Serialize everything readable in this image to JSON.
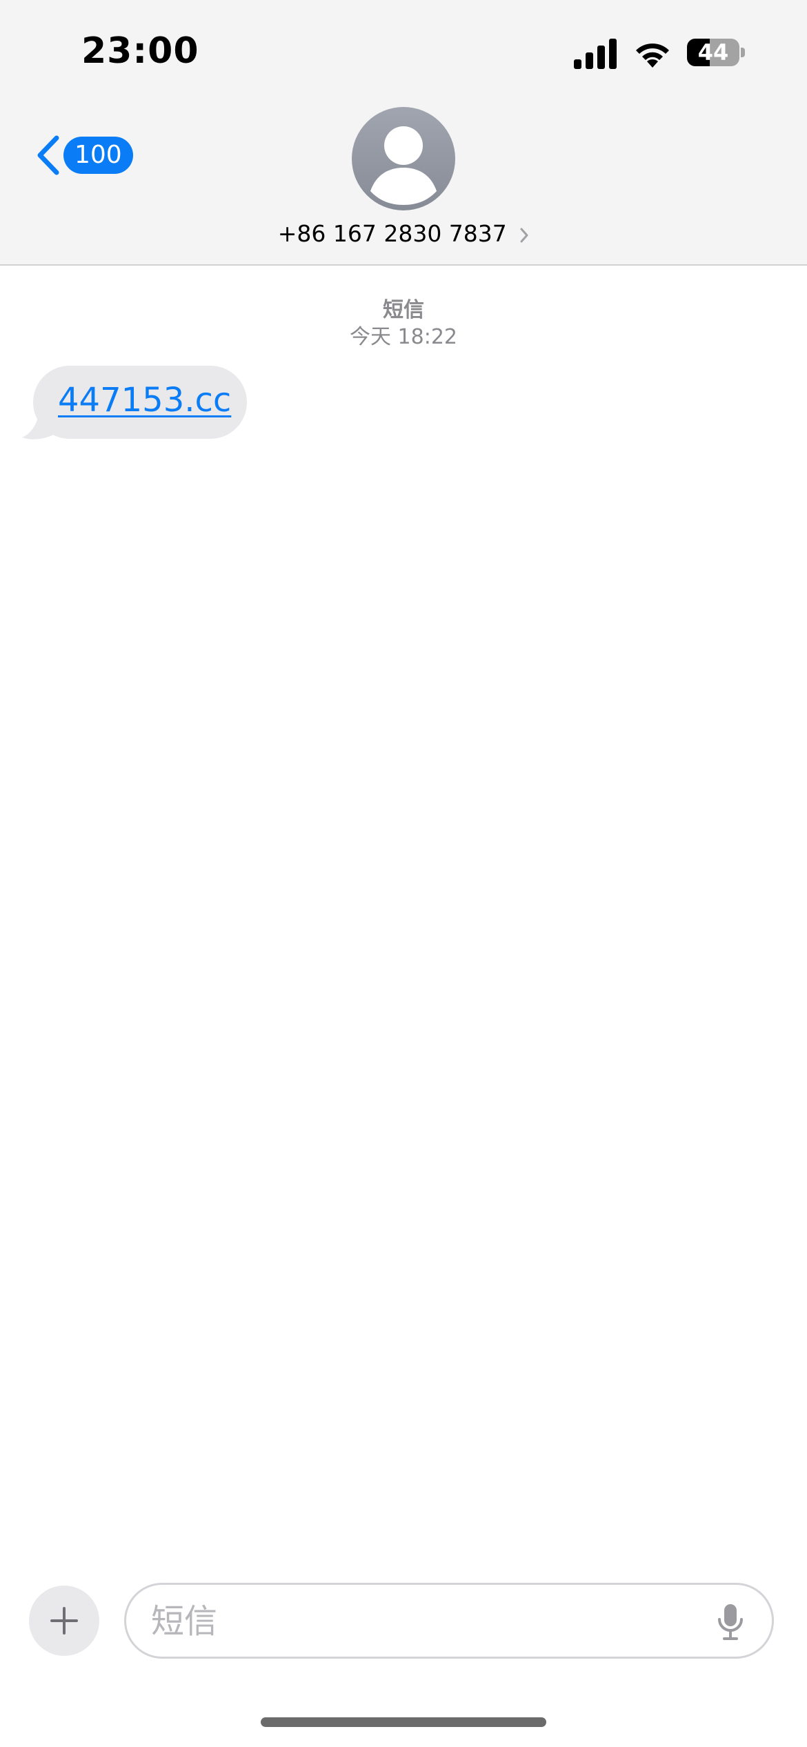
{
  "status_bar": {
    "time": "23:00",
    "battery_level": "44",
    "battery_fraction": 0.44,
    "icons": [
      "cellular-signal-icon",
      "wifi-icon",
      "battery-icon"
    ]
  },
  "nav": {
    "back_badge": "100",
    "contact_number": "+86 167 2830 7837",
    "icons": [
      "chevron-left-icon",
      "person-avatar-icon",
      "chevron-right-icon"
    ]
  },
  "conversation": {
    "service_label": "短信",
    "timestamp": "今天 18:22",
    "messages": [
      {
        "direction": "incoming",
        "text": "447153.cc",
        "is_link": true
      }
    ]
  },
  "composer": {
    "placeholder": "短信",
    "value": "",
    "icons": [
      "plus-icon",
      "microphone-icon"
    ]
  },
  "colors": {
    "accent": "#0a7cf6",
    "header_bg": "#f4f4f4",
    "incoming_bubble": "#e9e9eb",
    "meta_text": "#8a8a8e"
  }
}
